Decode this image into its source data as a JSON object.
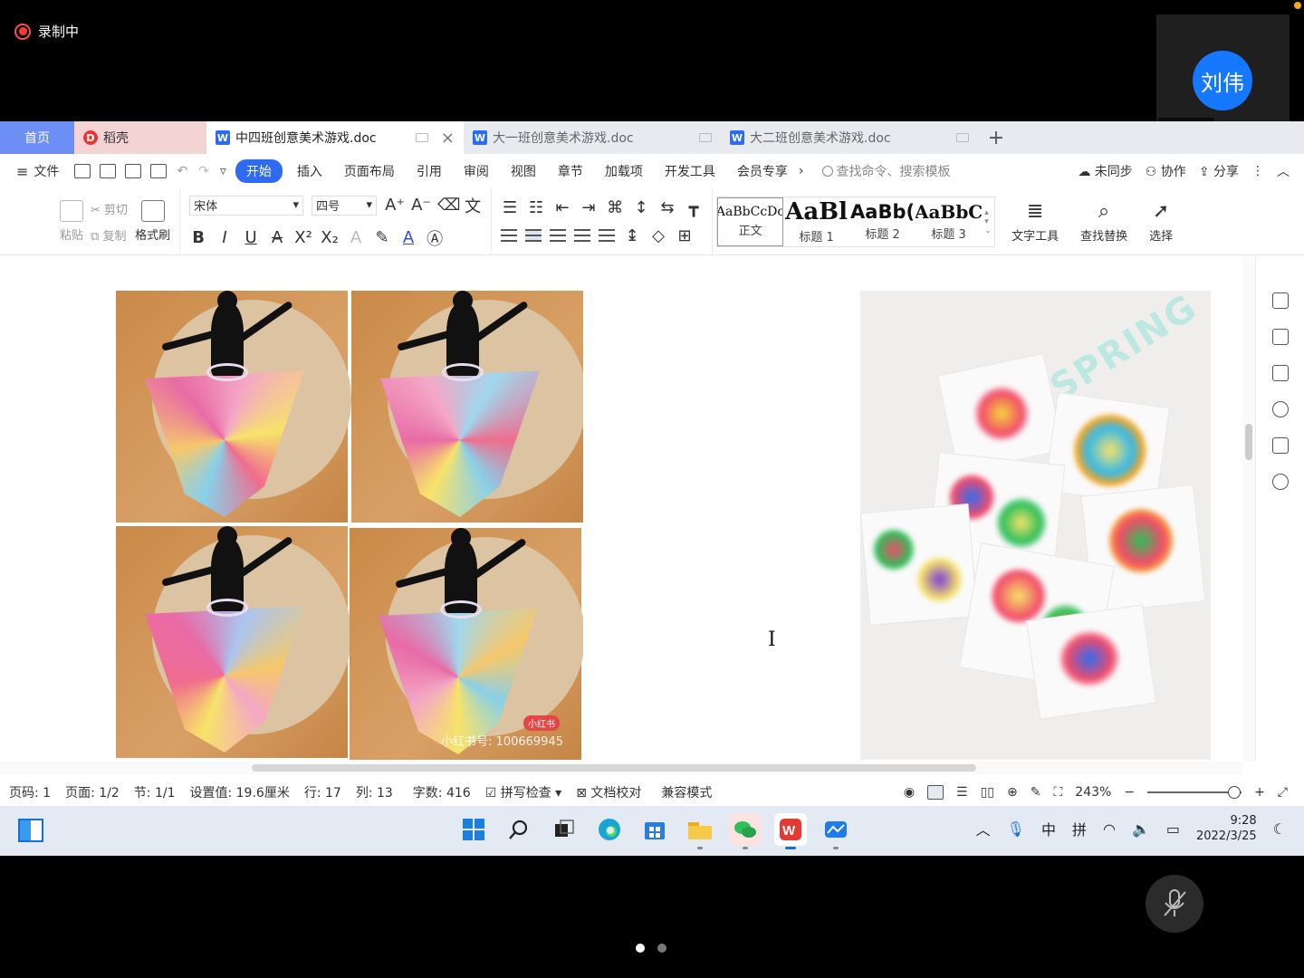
{
  "meeting": {
    "recording_label": "录制中",
    "self_avatar_text": "刘伟",
    "self_name": "刘伟",
    "colors": {
      "recording": "#ff3b30",
      "avatar": "#1677ff",
      "mic_active": "#35d07f"
    }
  },
  "wps": {
    "tabs": {
      "home": "首页",
      "daoke": "稻壳",
      "docs": [
        {
          "name": "中四班创意美术游戏.doc",
          "active": true
        },
        {
          "name": "大一班创意美术游戏.doc",
          "active": false
        },
        {
          "name": "大二班创意美术游戏.doc",
          "active": false
        }
      ],
      "add": "+"
    },
    "menu": {
      "file": "文件",
      "items": [
        "开始",
        "插入",
        "页面布局",
        "引用",
        "审阅",
        "视图",
        "章节",
        "加载项",
        "开发工具",
        "会员专享"
      ],
      "active": "开始",
      "more": "›",
      "search_placeholder": "查找命令、搜索模板",
      "right": [
        "未同步",
        "协作",
        "分享"
      ]
    },
    "ribbon": {
      "paste": "粘贴",
      "cut": "剪切",
      "copy": "复制",
      "format_painter": "格式刷",
      "font_name": "宋体",
      "font_size": "四号",
      "styles": [
        {
          "sample": "AaBbCcDc",
          "label": "正文"
        },
        {
          "sample": "AaBl",
          "label": "标题 1"
        },
        {
          "sample": "AaBb(",
          "label": "标题 2"
        },
        {
          "sample": "AaBbC",
          "label": "标题 3"
        }
      ],
      "text_tools": "文字工具",
      "find_replace": "查找替换",
      "select": "选择"
    },
    "document": {
      "watermark_text": "小红书号: 100669945",
      "badge": "小红书",
      "spring_text": "SPRING"
    },
    "status": {
      "page_code": "页码: 1",
      "page": "页面: 1/2",
      "section": "节: 1/1",
      "setting": "设置值: 19.6厘米",
      "row": "行: 17",
      "col": "列: 13",
      "words": "字数: 416",
      "spell": "拼写检查",
      "proof": "文档校对",
      "compat": "兼容模式",
      "zoom": "243%",
      "zoom_level": 0.92
    }
  },
  "taskbar": {
    "ime_lang": "中",
    "ime_mode": "拼",
    "time": "9:28",
    "date": "2022/3/25"
  }
}
